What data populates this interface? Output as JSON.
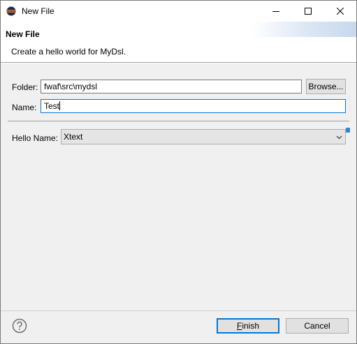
{
  "window": {
    "title": "New File",
    "minimize_icon": "minimize-icon",
    "maximize_icon": "maximize-icon",
    "close_icon": "close-icon"
  },
  "header": {
    "title": "New File",
    "description": "Create a hello world for MyDsl."
  },
  "form": {
    "folder_label": "Folder:",
    "folder_value": "fwaf\\src\\mydsl",
    "browse_label": "Browse...",
    "name_label": "Name:",
    "name_value": "Test",
    "hello_name_label": "Hello Name:",
    "hello_name_selected": "Xtext"
  },
  "footer": {
    "help_icon": "help-icon",
    "finish_mnemonic": "F",
    "finish_rest": "inish",
    "cancel_label": "Cancel"
  },
  "colors": {
    "accent": "#0078d7",
    "dialog_bg": "#f0f0f0",
    "header_bg": "#ffffff"
  }
}
